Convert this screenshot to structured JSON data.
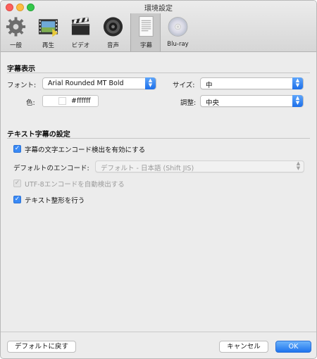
{
  "window": {
    "title": "環境設定"
  },
  "toolbar": {
    "items": [
      {
        "label": "一般",
        "icon": "gear-icon"
      },
      {
        "label": "再生",
        "icon": "film-icon"
      },
      {
        "label": "ビデオ",
        "icon": "clapper-icon"
      },
      {
        "label": "音声",
        "icon": "speaker-icon"
      },
      {
        "label": "字幕",
        "icon": "document-icon",
        "selected": true
      },
      {
        "label": "Blu-ray",
        "icon": "disc-icon"
      }
    ]
  },
  "subtitle_display": {
    "title": "字幕表示",
    "font_label": "フォント:",
    "font_value": "Arial Rounded MT Bold",
    "size_label": "サイズ:",
    "size_value": "中",
    "color_label": "色:",
    "color_value": "#ffffff",
    "adjust_label": "調整:",
    "adjust_value": "中央"
  },
  "text_subtitle_settings": {
    "title": "テキスト字幕の設定",
    "enable_encoding_detection": {
      "label": "字幕の文字エンコード検出を有効にする",
      "checked": true
    },
    "default_encoding_label": "デフォルトのエンコード:",
    "default_encoding_value": "デフォルト - 日本語 (Shift JIS)",
    "utf8_auto": {
      "label": "UTF-8エンコードを自動検出する",
      "checked": true,
      "disabled": true
    },
    "text_shaping": {
      "label": "テキスト整形を行う",
      "checked": true
    }
  },
  "footer": {
    "restore_defaults": "デフォルトに戻す",
    "cancel": "キャンセル",
    "ok": "OK"
  },
  "colors": {
    "accent": "#3a8af5",
    "window_bg": "#ececec"
  }
}
